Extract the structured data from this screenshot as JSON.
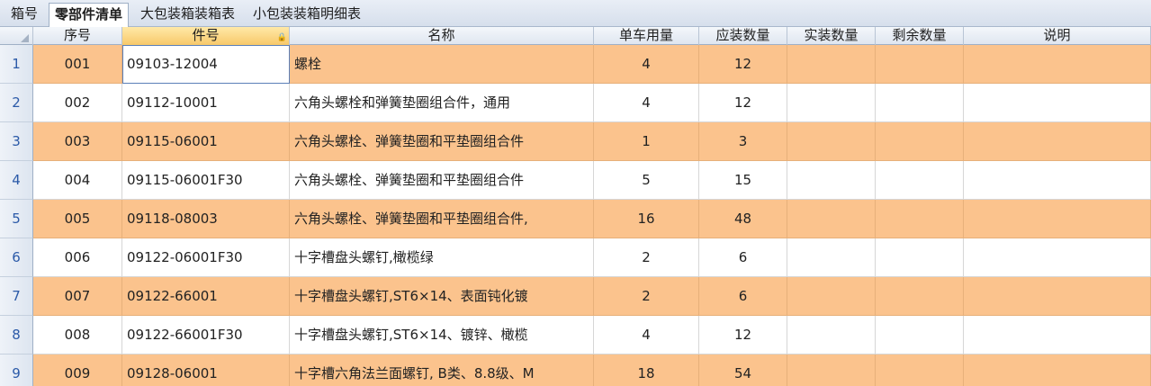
{
  "tabs": [
    {
      "label": "箱号"
    },
    {
      "label": "零部件清单"
    },
    {
      "label": "大包装箱装箱表"
    },
    {
      "label": "小包装装箱明细表"
    }
  ],
  "active_tab": 1,
  "columns": [
    {
      "label": "序号"
    },
    {
      "label": "件号"
    },
    {
      "label": "名称"
    },
    {
      "label": "单车用量"
    },
    {
      "label": "应装数量"
    },
    {
      "label": "实装数量"
    },
    {
      "label": "剩余数量"
    },
    {
      "label": "说明"
    }
  ],
  "rows": [
    {
      "num": "1",
      "seq": "001",
      "part_no": "09103-12004",
      "name": "螺栓",
      "per_vehicle": "4",
      "should_pack": "12",
      "actual": "",
      "remaining": "",
      "note": ""
    },
    {
      "num": "2",
      "seq": "002",
      "part_no": "09112-10001",
      "name": "六角头螺栓和弹簧垫圈组合件，通用",
      "per_vehicle": "4",
      "should_pack": "12",
      "actual": "",
      "remaining": "",
      "note": ""
    },
    {
      "num": "3",
      "seq": "003",
      "part_no": "09115-06001",
      "name": "六角头螺栓、弹簧垫圈和平垫圈组合件",
      "per_vehicle": "1",
      "should_pack": "3",
      "actual": "",
      "remaining": "",
      "note": ""
    },
    {
      "num": "4",
      "seq": "004",
      "part_no": "09115-06001F30",
      "name": "六角头螺栓、弹簧垫圈和平垫圈组合件",
      "per_vehicle": "5",
      "should_pack": "15",
      "actual": "",
      "remaining": "",
      "note": ""
    },
    {
      "num": "5",
      "seq": "005",
      "part_no": "09118-08003",
      "name": "六角头螺栓、弹簧垫圈和平垫圈组合件,",
      "per_vehicle": "16",
      "should_pack": "48",
      "actual": "",
      "remaining": "",
      "note": ""
    },
    {
      "num": "6",
      "seq": "006",
      "part_no": "09122-06001F30",
      "name": "十字槽盘头螺钉,橄榄绿",
      "per_vehicle": "2",
      "should_pack": "6",
      "actual": "",
      "remaining": "",
      "note": ""
    },
    {
      "num": "7",
      "seq": "007",
      "part_no": "09122-66001",
      "name": "十字槽盘头螺钉,ST6×14、表面钝化镀",
      "per_vehicle": "2",
      "should_pack": "6",
      "actual": "",
      "remaining": "",
      "note": ""
    },
    {
      "num": "8",
      "seq": "008",
      "part_no": "09122-66001F30",
      "name": "十字槽盘头螺钉,ST6×14、镀锌、橄榄",
      "per_vehicle": "4",
      "should_pack": "12",
      "actual": "",
      "remaining": "",
      "note": ""
    },
    {
      "num": "9",
      "seq": "009",
      "part_no": "09128-06001",
      "name": "十字槽六角法兰面螺钉, B类、8.8级、M",
      "per_vehicle": "18",
      "should_pack": "54",
      "actual": "",
      "remaining": "",
      "note": ""
    }
  ],
  "colors": {
    "row_highlight": "#fbc38d",
    "row_plain": "#ffffff",
    "row_number_text": "#2b5aa8",
    "selected_header": "#f8c96a"
  }
}
